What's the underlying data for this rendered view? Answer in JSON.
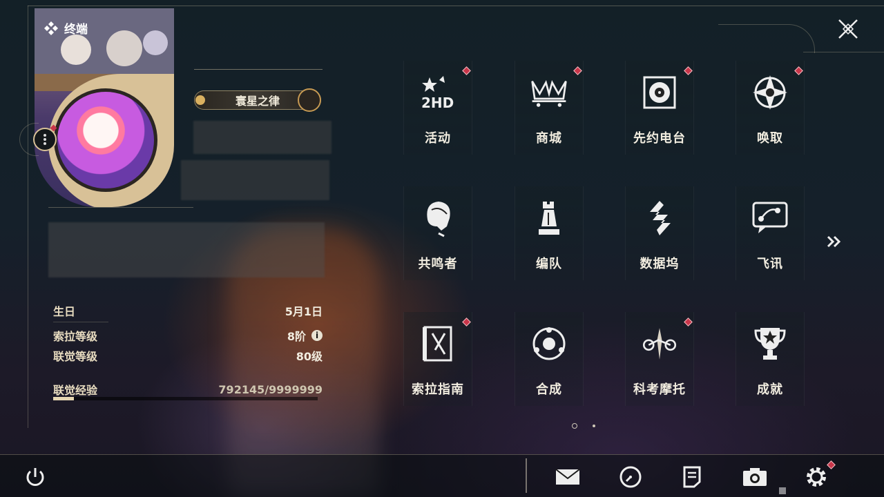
{
  "header": {
    "terminal_label": "终端"
  },
  "profile": {
    "title_badge": "寰星之律",
    "stats": [
      {
        "label": "生日",
        "value": "5月1日"
      },
      {
        "label": "索拉等级",
        "value": "8阶"
      },
      {
        "label": "联觉等级",
        "value": "80级"
      }
    ],
    "xp": {
      "label": "联觉经验",
      "value": "792145/9999999",
      "fraction": 0.079
    }
  },
  "menu": {
    "items": [
      {
        "label": "活动",
        "icon": "event-2hd-icon",
        "notify": true
      },
      {
        "label": "商城",
        "icon": "shop-crown-icon",
        "notify": true
      },
      {
        "label": "先约电台",
        "icon": "radio-icon",
        "notify": true
      },
      {
        "label": "唤取",
        "icon": "summon-compass-icon",
        "notify": true
      },
      {
        "label": "共鸣者",
        "icon": "resonator-portrait-icon",
        "notify": false
      },
      {
        "label": "编队",
        "icon": "chess-team-icon",
        "notify": false
      },
      {
        "label": "数据坞",
        "icon": "data-bank-icon",
        "notify": false
      },
      {
        "label": "飞讯",
        "icon": "chat-message-icon",
        "notify": false
      },
      {
        "label": "索拉指南",
        "icon": "guide-book-icon",
        "notify": true
      },
      {
        "label": "合成",
        "icon": "synthesis-orb-icon",
        "notify": false
      },
      {
        "label": "科考摩托",
        "icon": "motorbike-icon",
        "notify": true
      },
      {
        "label": "成就",
        "icon": "trophy-icon",
        "notify": false
      }
    ],
    "page_current": 1,
    "page_count": 2
  },
  "bottom_bar": {
    "icons": [
      "power-icon",
      "mail-icon",
      "clock-icon",
      "notes-icon",
      "camera-icon",
      "settings-gear-icon"
    ]
  },
  "colors": {
    "notify": "#c9364a",
    "accent_gold": "#d8c197",
    "text": "#f2ede0"
  }
}
